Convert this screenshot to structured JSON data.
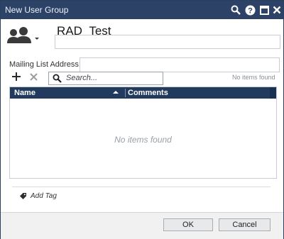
{
  "window": {
    "title": "New User Group"
  },
  "titlebar_icons": [
    "search-icon",
    "help-icon",
    "maximize-icon",
    "close-icon"
  ],
  "group": {
    "name": "RAD_Test",
    "name_input_value": ""
  },
  "mailing": {
    "label": "Mailing List Address:",
    "value": ""
  },
  "search": {
    "placeholder": "Search...",
    "value": "",
    "no_items": "No items found"
  },
  "table": {
    "columns": [
      "Name",
      "Comments"
    ],
    "empty_text": "No items found"
  },
  "tags": {
    "add_label": "Add Tag"
  },
  "buttons": {
    "ok": "OK",
    "cancel": "Cancel"
  },
  "colors": {
    "titlebar": "#2c4266",
    "header": "#223a5e"
  }
}
